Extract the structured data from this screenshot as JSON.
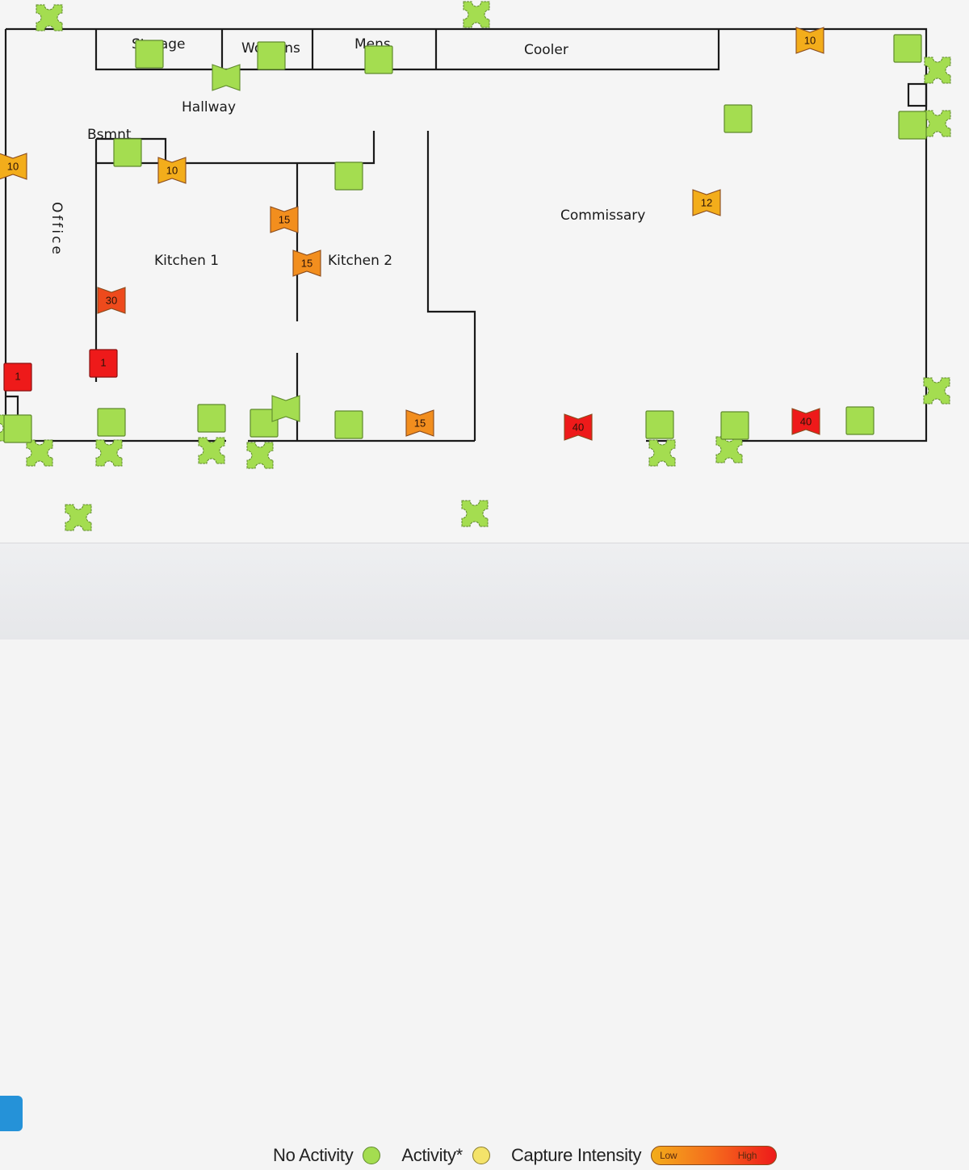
{
  "rooms": [
    {
      "id": "storage",
      "label": "Storage"
    },
    {
      "id": "womens",
      "label": "Womens"
    },
    {
      "id": "mens",
      "label": "Mens"
    },
    {
      "id": "cooler",
      "label": "Cooler"
    },
    {
      "id": "hallway",
      "label": "Hallway"
    },
    {
      "id": "bsmnt",
      "label": "Bsmnt"
    },
    {
      "id": "office",
      "label": "Office"
    },
    {
      "id": "kitchen1",
      "label": "Kitchen 1"
    },
    {
      "id": "kitchen2",
      "label": "Kitchen 2"
    },
    {
      "id": "commissary",
      "label": "Commissary"
    }
  ],
  "colors": {
    "no_activity": "#a4dd50",
    "activity": "#f4e36a",
    "intensity_low": "#f3ad1b",
    "intensity_mid": "#f28e1e",
    "intensity_high": "#ee1a1a",
    "wall": "#1a1a1a",
    "action_button": "#2592d8"
  },
  "devices": {
    "bait_stations": [
      {
        "status": "no-activity"
      },
      {
        "status": "no-activity"
      },
      {
        "status": "no-activity"
      },
      {
        "status": "no-activity"
      },
      {
        "status": "no-activity"
      },
      {
        "status": "no-activity"
      },
      {
        "status": "no-activity"
      },
      {
        "status": "no-activity"
      },
      {
        "status": "no-activity"
      },
      {
        "status": "no-activity"
      },
      {
        "status": "no-activity"
      },
      {
        "status": "no-activity"
      },
      {
        "status": "no-activity"
      },
      {
        "status": "no-activity"
      }
    ],
    "monitors": [
      {
        "status": "no-activity",
        "count": ""
      },
      {
        "status": "no-activity",
        "count": ""
      },
      {
        "status": "no-activity",
        "count": ""
      },
      {
        "status": "no-activity",
        "count": ""
      },
      {
        "status": "no-activity",
        "count": ""
      },
      {
        "status": "no-activity",
        "count": ""
      },
      {
        "status": "no-activity",
        "count": ""
      },
      {
        "status": "no-activity",
        "count": ""
      },
      {
        "status": "no-activity",
        "count": ""
      },
      {
        "status": "no-activity",
        "count": ""
      },
      {
        "status": "no-activity",
        "count": ""
      },
      {
        "status": "no-activity",
        "count": ""
      },
      {
        "status": "no-activity",
        "count": ""
      },
      {
        "status": "no-activity",
        "count": ""
      },
      {
        "status": "no-activity",
        "count": ""
      },
      {
        "status": "no-activity",
        "count": ""
      },
      {
        "status": "no-activity",
        "count": ""
      },
      {
        "status": "capture",
        "count": "1"
      },
      {
        "status": "capture",
        "count": "1"
      }
    ],
    "traps": [
      {
        "status": "no-activity",
        "count": ""
      },
      {
        "status": "no-activity",
        "count": ""
      },
      {
        "status": "capture",
        "count": "10"
      },
      {
        "status": "capture",
        "count": "10"
      },
      {
        "status": "capture",
        "count": "10"
      },
      {
        "status": "capture",
        "count": "15"
      },
      {
        "status": "capture",
        "count": "15"
      },
      {
        "status": "capture",
        "count": "15"
      },
      {
        "status": "capture",
        "count": "12"
      },
      {
        "status": "capture",
        "count": "30"
      },
      {
        "status": "capture",
        "count": "40"
      },
      {
        "status": "capture",
        "count": "40"
      }
    ]
  },
  "legend": {
    "no_activity": "No Activity",
    "activity": "Activity*",
    "capture_intensity": "Capture Intensity",
    "low": "Low",
    "high": "High"
  }
}
